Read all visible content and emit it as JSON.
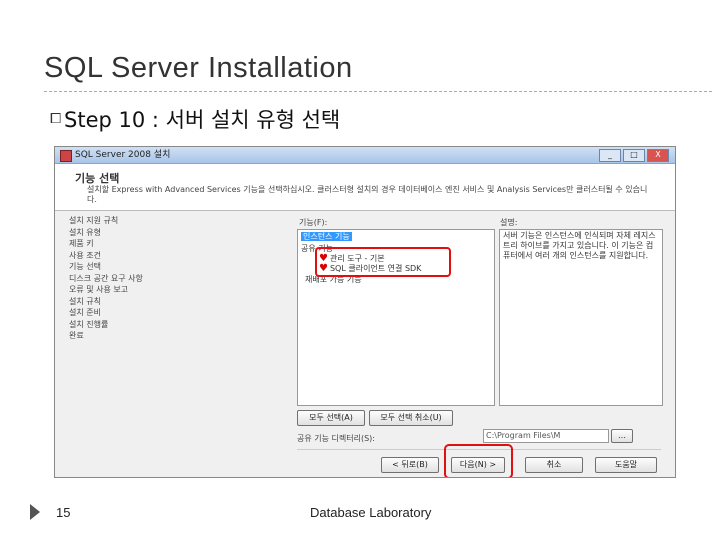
{
  "slide": {
    "title": "SQL Server Installation",
    "bullet_icon": "square-bullet",
    "step": "Step 10 : 서버 설치 유형 선택",
    "page_number": "15",
    "footer": "Database Laboratory"
  },
  "window": {
    "title": "SQL Server 2008 설치",
    "buttons": [
      "_",
      "□",
      "X"
    ]
  },
  "header": {
    "title": "기능 선택",
    "description": "설치할 Express with Advanced Services 기능을 선택하십시오. 클러스터형 설치의 경우 데이터베이스 엔진 서비스 및 Analysis Services만 클러스터될 수 있습니다."
  },
  "steps": [
    "설치 지원 규칙",
    "설치 유형",
    "제품 키",
    "사용 조건",
    "기능 선택",
    "디스크 공간 요구 사항",
    "오류 및 사용 보고",
    "설치 규칙",
    "설치 준비",
    "설치 진행률",
    "완료"
  ],
  "features": {
    "label": "기능(F):",
    "items": [
      {
        "text": "인스턴스 기능",
        "selected": true
      },
      {
        "text": "공유 기능",
        "selected": false
      },
      {
        "text": "관리 도구 - 기본",
        "selected": false,
        "marked": true
      },
      {
        "text": "SQL 클라이언트 연결 SDK",
        "selected": false,
        "marked": true
      },
      {
        "text": "재배포 가능 기능",
        "selected": false
      }
    ]
  },
  "description": {
    "label": "설명:",
    "text": "서버 기능은 인스턴스에 인식되며 자체 레지스트리 하이브를 가지고 있습니다. 이 기능은 컴퓨터에서 여러 개의 인스턴스를 지원합니다."
  },
  "buttons": {
    "select_all": "모두 선택(A)",
    "unselect_all": "모두 선택 취소(U)",
    "back": "< 뒤로(B)",
    "next": "다음(N) >",
    "cancel": "취소",
    "help": "도움말"
  },
  "shared_dir": {
    "label": "공유 기능 디렉터리(S):",
    "value": "C:\\Program Files\\M"
  }
}
